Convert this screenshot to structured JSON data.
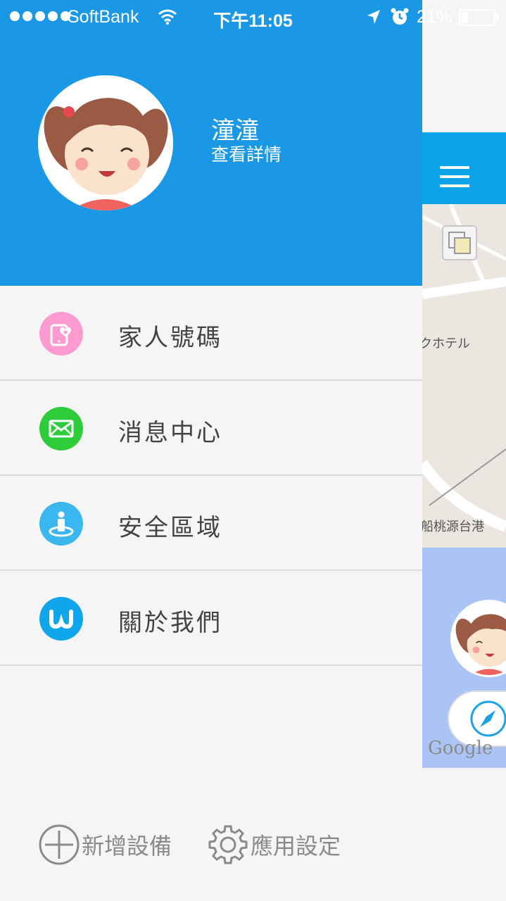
{
  "status_bar": {
    "carrier": "SoftBank",
    "time": "下午11:05",
    "battery": "21%",
    "battery_level": 0.21,
    "icons": [
      "signal-dots-icon",
      "wifi-icon",
      "location-arrow-icon",
      "alarm-icon",
      "battery-icon"
    ]
  },
  "profile": {
    "name": "潼潼",
    "detail_link": "查看詳情"
  },
  "menu": {
    "items": [
      {
        "label": "家人號碼",
        "icon": "family-phone-icon",
        "color": "#fd9bd0"
      },
      {
        "label": "消息中心",
        "icon": "envelope-icon",
        "color": "#2ecc3a"
      },
      {
        "label": "安全區域",
        "icon": "safe-zone-person-icon",
        "color": "#3bb7ef"
      },
      {
        "label": "關於我們",
        "icon": "w-logo-icon",
        "color": "#10a6ec"
      }
    ]
  },
  "bottom": {
    "add_device": "新增設備",
    "app_settings": "應用設定"
  },
  "map": {
    "labels": [
      "クホテル",
      "船桃源台港"
    ],
    "google": "Google"
  },
  "colors": {
    "header_blue": "#1a98e6",
    "map_topbar": "#0ba3ea",
    "water": "#a9c4f5"
  }
}
